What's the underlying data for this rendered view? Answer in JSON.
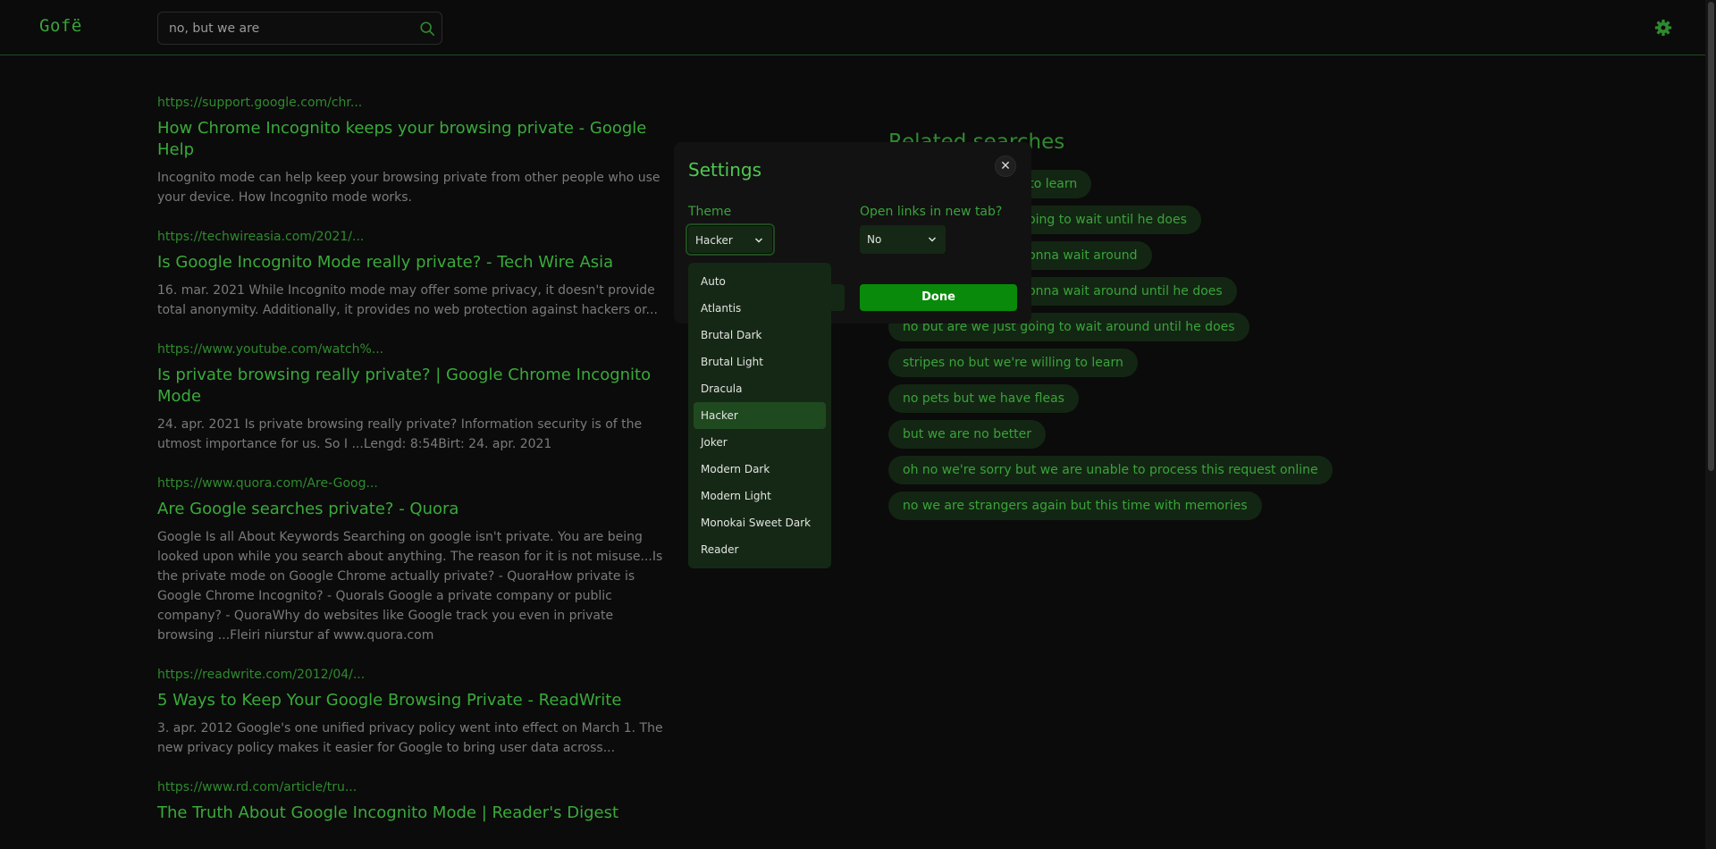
{
  "header": {
    "logo": "Gofë",
    "search_value": "no, but we are"
  },
  "results": [
    {
      "url": "https://support.google.com/chr...",
      "title": "How Chrome Incognito keeps your browsing private - Google Help",
      "snippet": "Incognito mode can help keep your browsing private from other people who use your device. How Incognito mode works."
    },
    {
      "url": "https://techwireasia.com/2021/...",
      "title": "Is Google Incognito Mode really private? - Tech Wire Asia",
      "snippet": "16. mar. 2021 While Incognito mode may offer some privacy, it doesn't provide total anonymity. Additionally, it provides no web protection against hackers or..."
    },
    {
      "url": "https://www.youtube.com/watch%...",
      "title": "Is private browsing really private? | Google Chrome Incognito Mode",
      "snippet": "24. apr. 2021 Is private browsing really private? Information security is of the utmost importance for us. So I ...Lengd: 8:54Birt: 24. apr. 2021"
    },
    {
      "url": "https://www.quora.com/Are-Goog...",
      "title": "Are Google searches private? - Quora",
      "snippet": "Google Is all About Keywords Searching on google isn't private. You are being looked upon while you search about anything. The reason for it is not misuse...Is the private mode on Google Chrome actually private? - QuoraHow private is Google Chrome Incognito? - QuoraIs Google a private company or public company? - QuoraWhy do websites like Google track you even in private browsing ...Fleiri niurstur af www.quora.com"
    },
    {
      "url": "https://readwrite.com/2012/04/...",
      "title": "5 Ways to Keep Your Google Browsing Private - ReadWrite",
      "snippet": "3. apr. 2012 Google's one unified privacy policy went into effect on March 1. The new privacy policy makes it easier for Google to bring user data across..."
    },
    {
      "url": "https://www.rd.com/article/tru...",
      "title": "The Truth About Google Incognito Mode | Reader's Digest",
      "snippet": ""
    }
  ],
  "related": {
    "title": "Related searches",
    "items": [
      "no but we're willing to learn",
      "no but are we just going to wait until he does",
      "no but are we just gonna wait around",
      "no but are we just gonna wait around until he does",
      "no but are we just going to wait around until he does",
      "stripes no but we're willing to learn",
      "no pets but we have fleas",
      "but we are no better",
      "oh no we're sorry but we are unable to process this request online",
      "no we are strangers again but this time with memories"
    ]
  },
  "settings": {
    "title": "Settings",
    "close_label": "✕",
    "theme_label": "Theme",
    "theme_value": "Hacker",
    "newtab_label": "Open links in new tab?",
    "newtab_value": "No",
    "done_label": "Done",
    "theme_options": [
      "Auto",
      "Atlantis",
      "Brutal Dark",
      "Brutal Light",
      "Dracula",
      "Hacker",
      "Joker",
      "Modern Dark",
      "Modern Light",
      "Monokai Sweet Dark",
      "Reader"
    ],
    "selected_theme_index": 5
  },
  "colors": {
    "accent": "#3aa33a",
    "background": "#0b0b0b",
    "done_button": "#0a8a0a",
    "chip_background": "#132613"
  }
}
